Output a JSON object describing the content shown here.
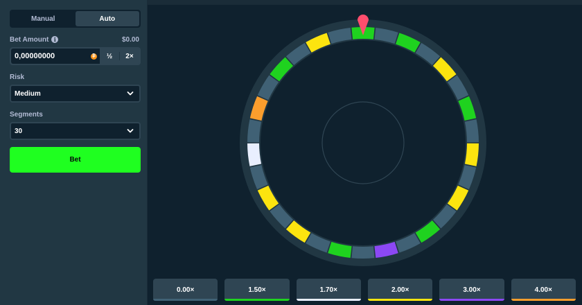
{
  "mode": {
    "manual_label": "Manual",
    "auto_label": "Auto",
    "active": "manual"
  },
  "bet_amount": {
    "label": "Bet Amount",
    "usd_value": "$0.00",
    "value": "0,00000000",
    "half_label": "½",
    "double_label": "2×",
    "currency_icon": "bitcoin-coin-icon"
  },
  "risk": {
    "label": "Risk",
    "selected": "Medium"
  },
  "segments": {
    "label": "Segments",
    "selected": "30"
  },
  "bet_button_label": "Bet",
  "colors": {
    "accent_green": "#1fff20",
    "panel": "#213743",
    "game_bg": "#0f212e",
    "seg_base": "#406175",
    "seg_green": "#1fd21f",
    "seg_yellow": "#fce40f",
    "seg_white": "#e9efff",
    "seg_purple": "#8c48f4",
    "seg_orange": "#fb9e2d",
    "pointer": "#ff4d6d"
  },
  "wheel": {
    "segment_count": 30,
    "segments": [
      "green",
      "base",
      "green",
      "base",
      "yellow",
      "base",
      "green",
      "base",
      "yellow",
      "base",
      "yellow",
      "base",
      "green",
      "base",
      "purple",
      "base",
      "green",
      "base",
      "yellow",
      "base",
      "yellow",
      "base",
      "white",
      "base",
      "orange",
      "base",
      "green",
      "base",
      "yellow",
      "base"
    ]
  },
  "multipliers": [
    {
      "label": "0.00×",
      "color": "#406175"
    },
    {
      "label": "1.50×",
      "color": "#1fd21f"
    },
    {
      "label": "1.70×",
      "color": "#e9efff"
    },
    {
      "label": "2.00×",
      "color": "#fce40f"
    },
    {
      "label": "3.00×",
      "color": "#8c48f4"
    },
    {
      "label": "4.00×",
      "color": "#fb9e2d"
    }
  ]
}
